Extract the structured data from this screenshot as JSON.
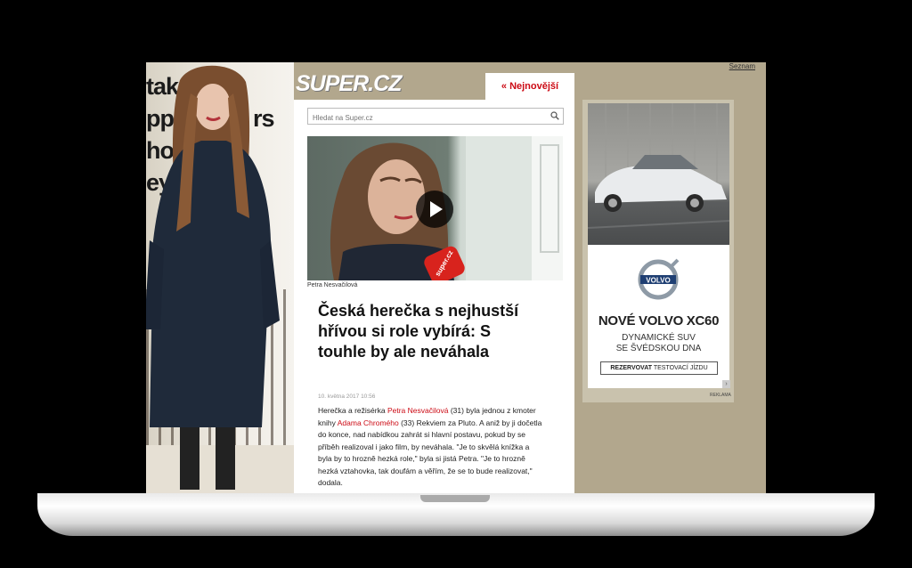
{
  "top_link": "Seznam",
  "logo": "SUPER.CZ",
  "latest_tab": "« Nejnovější",
  "search": {
    "placeholder": "Hledat na Super.cz"
  },
  "promo_words": [
    "tak",
    "pp",
    "hot",
    "ey"
  ],
  "promo_word_partial": "rs",
  "video": {
    "mic_label": "super.cz"
  },
  "article": {
    "photo_caption": "Petra Nesvačilová",
    "headline": "Česká herečka s nejhustší hřívou si role vybírá: S touhle by ale neváhala",
    "date": "10. května 2017 10:56",
    "body": {
      "t1": "Herečka a režisérka ",
      "link1": "Petra Nesvačilová",
      "t2": " (31) byla jednou z kmoter knihy ",
      "link2": "Adama Chromého",
      "t3": " (33) Rekviem za Pluto. A aniž by ji dočetla do konce, nad nabídkou zahrát si hlavní postavu, pokud by se příběh realizoval i jako film, by neváhala. \"Je to skvělá knížka a byla by to hrozně hezká role,\" byla si jistá Petra. \"Je to hrozně hezká vztahovka, tak doufám a věřím, že se to bude realizovat,\" dodala."
    }
  },
  "ad": {
    "brand_logo_text": "VOLVO",
    "title": "NOVÉ VOLVO XC60",
    "subtitle_line1": "DYNAMICKÉ SUV",
    "subtitle_line2": "SE ŠVÉDSKOU DNA",
    "button_bold": "REZERVOVAT",
    "button_rest": " TESTOVACÍ JÍZDU",
    "label": "REKLAMA"
  }
}
